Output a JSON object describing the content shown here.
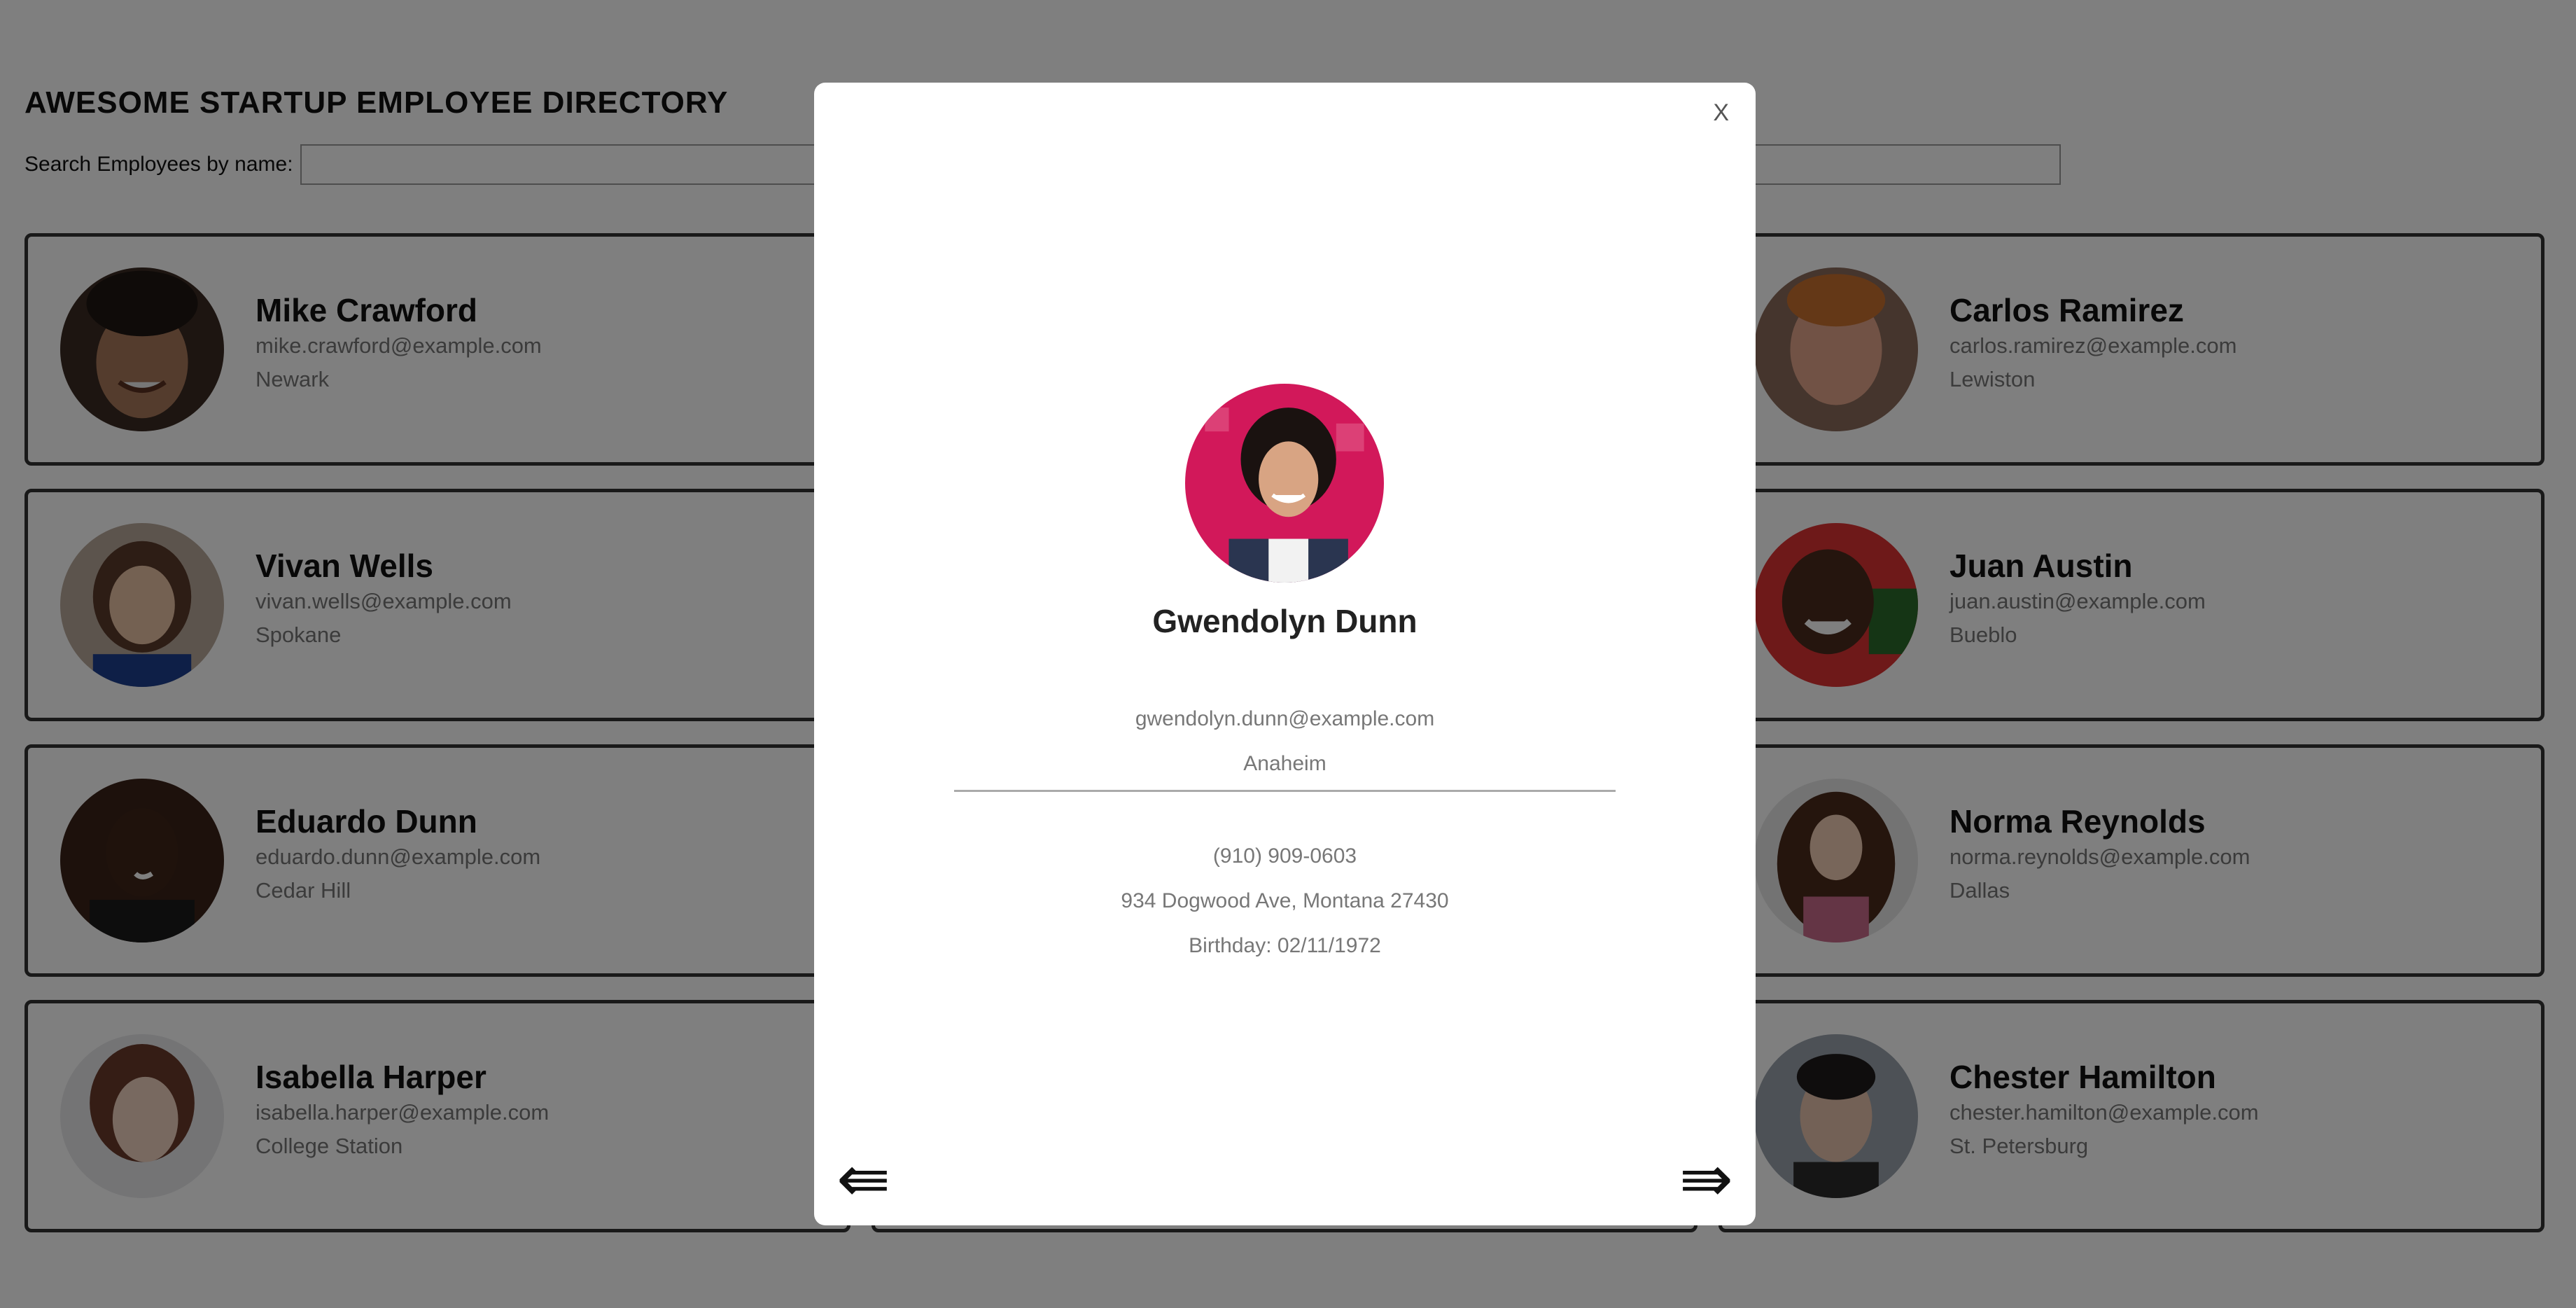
{
  "page": {
    "title": "AWESOME STARTUP EMPLOYEE DIRECTORY",
    "search": {
      "label": "Search Employees by name:",
      "value": "",
      "placeholder": ""
    }
  },
  "employees": [
    {
      "name": "Mike Crawford",
      "email": "mike.crawford@example.com",
      "city": "Newark"
    },
    {
      "name": "Carlos Ramirez",
      "email": "carlos.ramirez@example.com",
      "city": "Lewiston"
    },
    {
      "name": "Vivan Wells",
      "email": "vivan.wells@example.com",
      "city": "Spokane"
    },
    {
      "name": "Juan Austin",
      "email": "juan.austin@example.com",
      "city": "Bueblo"
    },
    {
      "name": "Eduardo Dunn",
      "email": "eduardo.dunn@example.com",
      "city": "Cedar Hill"
    },
    {
      "name": "Norma Reynolds",
      "email": "norma.reynolds@example.com",
      "city": "Dallas"
    },
    {
      "name": "Isabella Harper",
      "email": "isabella.harper@example.com",
      "city": "College Station"
    },
    {
      "name": "Chester Hamilton",
      "email": "chester.hamilton@example.com",
      "city": "St. Petersburg"
    }
  ],
  "modal": {
    "close_label": "X",
    "name": "Gwendolyn Dunn",
    "email": "gwendolyn.dunn@example.com",
    "city": "Anaheim",
    "phone": "(910) 909-0603",
    "address": "934 Dogwood Ave, Montana 27430",
    "birthday": "Birthday: 02/11/1972",
    "prev_label": "⇚",
    "next_label": "⇛"
  }
}
